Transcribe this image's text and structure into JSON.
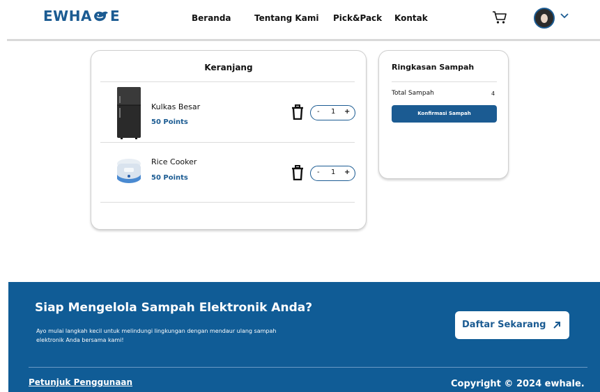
{
  "header": {
    "logo_left": "EWHA",
    "logo_right": "E",
    "nav": [
      "Beranda",
      "Tentang Kami",
      "Pick&Pack",
      "Kontak"
    ],
    "icons": {
      "cart": "cart-icon",
      "avatar": "avatar",
      "menu": "chevron-down-icon"
    },
    "brand_color": "#1b5b92"
  },
  "cart": {
    "title": "Keranjang",
    "items": [
      {
        "name": "Kulkas Besar",
        "points": "50 Points",
        "quantity": "1",
        "minus": "-",
        "plus": "+"
      },
      {
        "name": "Rice Cooker",
        "points": "50 Points",
        "quantity": "1",
        "minus": "-",
        "plus": "+"
      }
    ]
  },
  "summary": {
    "title": "Ringkasan Sampah",
    "total_label": "Total Sampah",
    "total_value": "4",
    "confirm_label": "Konfirmasi Sampah"
  },
  "footer": {
    "title": "Siap Mengelola Sampah Elektronik Anda?",
    "description": "Ayo mulai langkah kecil untuk melindungi lingkungan dengan mendaur ulang sampah elektronik Anda bersama kami!",
    "cta_label": "Daftar Sekarang",
    "guide_link": "Petunjuk Penggunaan",
    "copyright": "Copyright © 2024 ewhale.",
    "background_color": "#105c96"
  }
}
